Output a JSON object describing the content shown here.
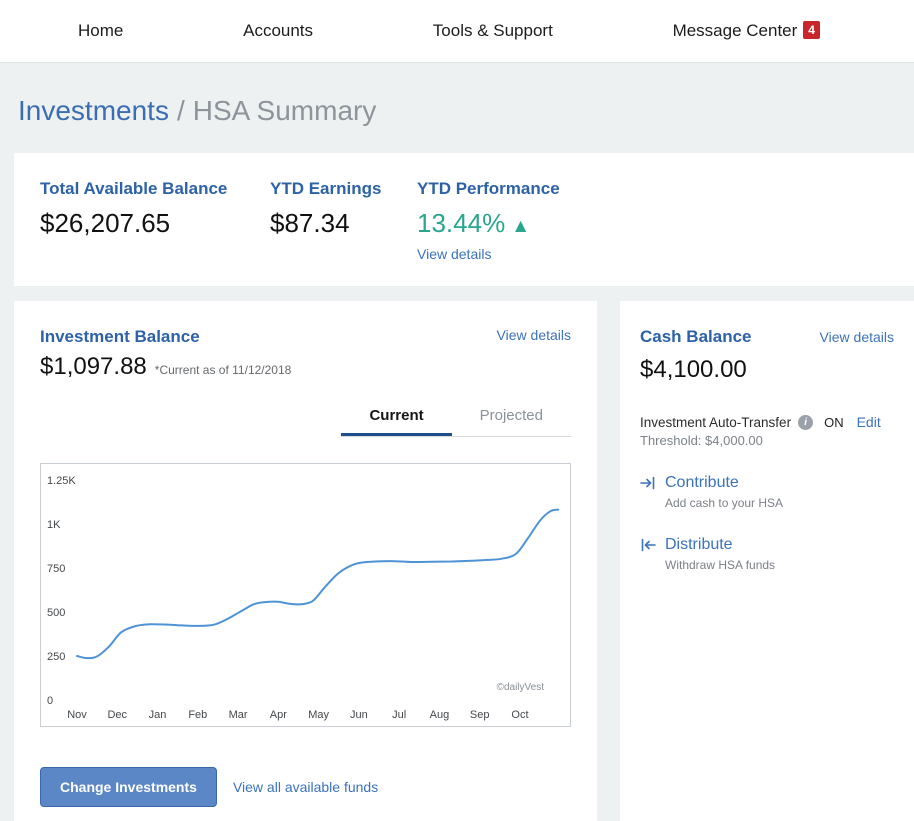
{
  "nav": {
    "items": [
      {
        "label": "Home"
      },
      {
        "label": "Accounts"
      },
      {
        "label": "Tools & Support"
      },
      {
        "label": "Message Center",
        "badge": "4"
      }
    ]
  },
  "breadcrumb": {
    "section": "Investments",
    "separator": "/",
    "page": "HSA Summary"
  },
  "summary": {
    "total_balance": {
      "label": "Total Available Balance",
      "value": "$26,207.65"
    },
    "ytd_earnings": {
      "label": "YTD Earnings",
      "value": "$87.34"
    },
    "ytd_performance": {
      "label": "YTD Performance",
      "value": "13.44%",
      "arrow": "▲",
      "direction": "up",
      "view_details": "View details"
    }
  },
  "investment": {
    "title": "Investment Balance",
    "view_details": "View details",
    "value": "$1,097.88",
    "as_of": "*Current as of 11/12/2018",
    "tabs": [
      {
        "label": "Current",
        "active": true
      },
      {
        "label": "Projected",
        "active": false
      }
    ],
    "change_button": "Change Investments",
    "view_funds_link": "View all available funds"
  },
  "cash": {
    "title": "Cash Balance",
    "view_details": "View details",
    "value": "$4,100.00",
    "auto_transfer": {
      "label": "Investment Auto-Transfer",
      "status": "ON",
      "edit": "Edit",
      "threshold": "Threshold: $4,000.00"
    },
    "actions": [
      {
        "label": "Contribute",
        "description": "Add cash to your HSA",
        "icon": "contribute-arrow-icon"
      },
      {
        "label": "Distribute",
        "description": "Withdraw HSA funds",
        "icon": "distribute-arrow-icon"
      }
    ]
  },
  "chart_data": {
    "type": "line",
    "title": "Investment Balance - Current (trailing 12 months)",
    "x_labels": [
      "Nov",
      "Dec",
      "Jan",
      "Feb",
      "Mar",
      "Apr",
      "May",
      "Jun",
      "Jul",
      "Aug",
      "Sep",
      "Oct"
    ],
    "y_ticks": [
      {
        "label": "0",
        "value": 0
      },
      {
        "label": "250",
        "value": 250
      },
      {
        "label": "500",
        "value": 500
      },
      {
        "label": "750",
        "value": 750
      },
      {
        "label": "1K",
        "value": 1000
      },
      {
        "label": "1.25K",
        "value": 1250
      }
    ],
    "ylim": [
      0,
      1250
    ],
    "grid": false,
    "line_color": "#4f93d6",
    "watermark": "©dailyVest",
    "series": [
      {
        "name": "Investment Balance",
        "x": [
          0,
          0.25,
          0.5,
          0.8,
          1.1,
          1.45,
          1.8,
          2.2,
          2.6,
          3.0,
          3.4,
          3.75,
          4.1,
          4.4,
          4.7,
          5.0,
          5.25,
          5.55,
          5.85,
          6.15,
          6.5,
          6.9,
          7.3,
          7.8,
          8.3,
          8.8,
          9.3,
          9.8,
          10.2,
          10.55,
          10.9,
          11.2,
          11.5,
          11.75,
          11.95
        ],
        "y": [
          250,
          238,
          248,
          305,
          385,
          420,
          430,
          429,
          424,
          421,
          428,
          462,
          508,
          545,
          557,
          558,
          548,
          544,
          562,
          640,
          722,
          772,
          786,
          789,
          784,
          786,
          787,
          791,
          796,
          803,
          830,
          920,
          1020,
          1072,
          1082
        ]
      }
    ]
  },
  "colors": {
    "heading_blue": "#2e62a6",
    "link_blue": "#3c73b9",
    "performance_green": "#2aa68c",
    "badge_red": "#c9252d",
    "chart_line_blue": "#4f93d6",
    "button_blue": "#5b87c7"
  }
}
